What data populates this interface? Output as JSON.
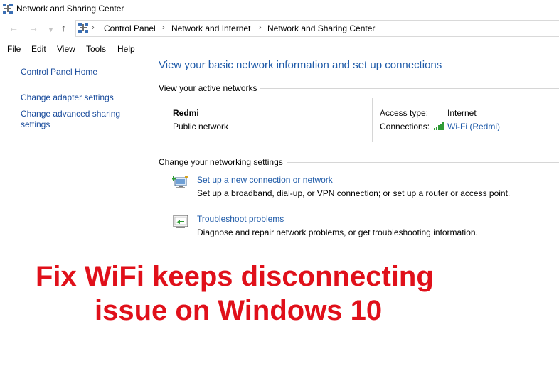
{
  "window": {
    "title": "Network and Sharing Center"
  },
  "address": {
    "crumbs": [
      "Control Panel",
      "Network and Internet",
      "Network and Sharing Center"
    ]
  },
  "menu": [
    "File",
    "Edit",
    "View",
    "Tools",
    "Help"
  ],
  "sidebar": {
    "home": "Control Panel Home",
    "adapter": "Change adapter settings",
    "advanced_line1": "Change advanced sharing",
    "advanced_line2": "settings"
  },
  "main": {
    "heading": "View your basic network information and set up connections",
    "active_label": "View your active networks",
    "network": {
      "name": "Redmi",
      "type": "Public network",
      "access_label": "Access type:",
      "access_value": "Internet",
      "connections_label": "Connections:",
      "connections_value": "Wi-Fi (Redmi)"
    },
    "change_label": "Change your networking settings",
    "tasks": [
      {
        "link": "Set up a new connection or network",
        "desc": "Set up a broadband, dial-up, or VPN connection; or set up a router or access point.",
        "icon": "new-connection-icon"
      },
      {
        "link": "Troubleshoot problems",
        "desc": "Diagnose and repair network problems, or get troubleshooting information.",
        "icon": "troubleshoot-icon"
      }
    ]
  },
  "overlay": {
    "line1": "Fix WiFi keeps disconnecting",
    "line2": "issue on Windows 10",
    "color": "#e0101a"
  },
  "colors": {
    "link": "#1e5aa8",
    "heading": "#1e5aa8"
  }
}
